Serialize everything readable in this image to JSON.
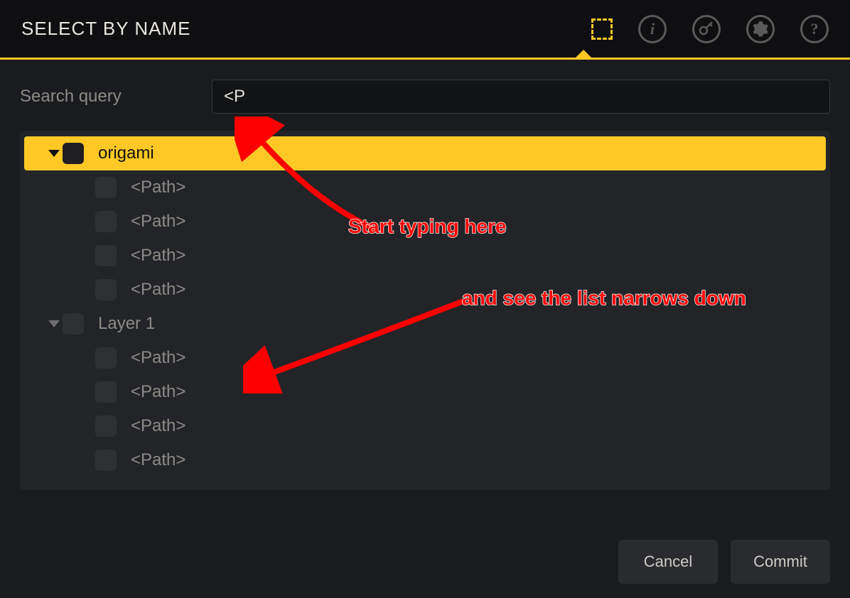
{
  "header": {
    "title": "SELECT BY NAME"
  },
  "search": {
    "label": "Search query",
    "value": "<P"
  },
  "tree": {
    "items": [
      {
        "label": "origami",
        "indent": 1,
        "disclosure": true,
        "selected": true
      },
      {
        "label": "<Path>",
        "indent": 2,
        "disclosure": false,
        "selected": false
      },
      {
        "label": "<Path>",
        "indent": 2,
        "disclosure": false,
        "selected": false
      },
      {
        "label": "<Path>",
        "indent": 2,
        "disclosure": false,
        "selected": false
      },
      {
        "label": "<Path>",
        "indent": 2,
        "disclosure": false,
        "selected": false
      },
      {
        "label": "Layer 1",
        "indent": 1,
        "disclosure": true,
        "selected": false
      },
      {
        "label": "<Path>",
        "indent": 2,
        "disclosure": false,
        "selected": false
      },
      {
        "label": "<Path>",
        "indent": 2,
        "disclosure": false,
        "selected": false
      },
      {
        "label": "<Path>",
        "indent": 2,
        "disclosure": false,
        "selected": false
      },
      {
        "label": "<Path>",
        "indent": 2,
        "disclosure": false,
        "selected": false
      }
    ]
  },
  "footer": {
    "cancel": "Cancel",
    "commit": "Commit"
  },
  "annotations": {
    "a1": "Start typing here",
    "a2": "and see the list narrows down"
  }
}
